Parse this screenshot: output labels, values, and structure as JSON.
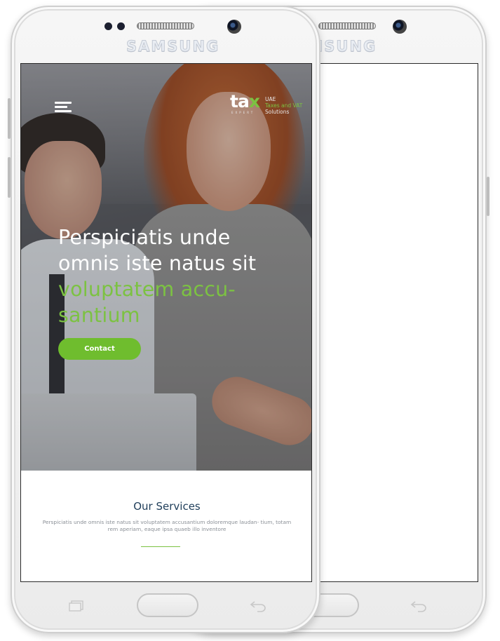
{
  "device": {
    "brand": "SAMSUNG"
  },
  "header": {
    "logo": {
      "word_part1": "ta",
      "word_part2": "x",
      "subtext": "EXPERT",
      "tagline_line1": "UAE",
      "tagline_line2": "Taxes and VAT",
      "tagline_line3": "Solutions"
    },
    "menu_icon": "hamburger-icon"
  },
  "hero": {
    "headline_line1": "Perspiciatis unde",
    "headline_line2": "omnis iste natus sit",
    "headline_line3": "voluptatem accu-",
    "headline_line4": "santium",
    "cta_label": "Contact"
  },
  "services": {
    "title": "Our Services",
    "description": "Perspiciatis unde omnis iste natus sit voluptatem accusantium doloremque laudan- tium, totam rem aperiam, eaque ipsa quaeb illo inventore"
  },
  "colors": {
    "accent_green": "#7cc242",
    "button_green": "#6fbd2e",
    "title_navy": "#1e3d59"
  }
}
